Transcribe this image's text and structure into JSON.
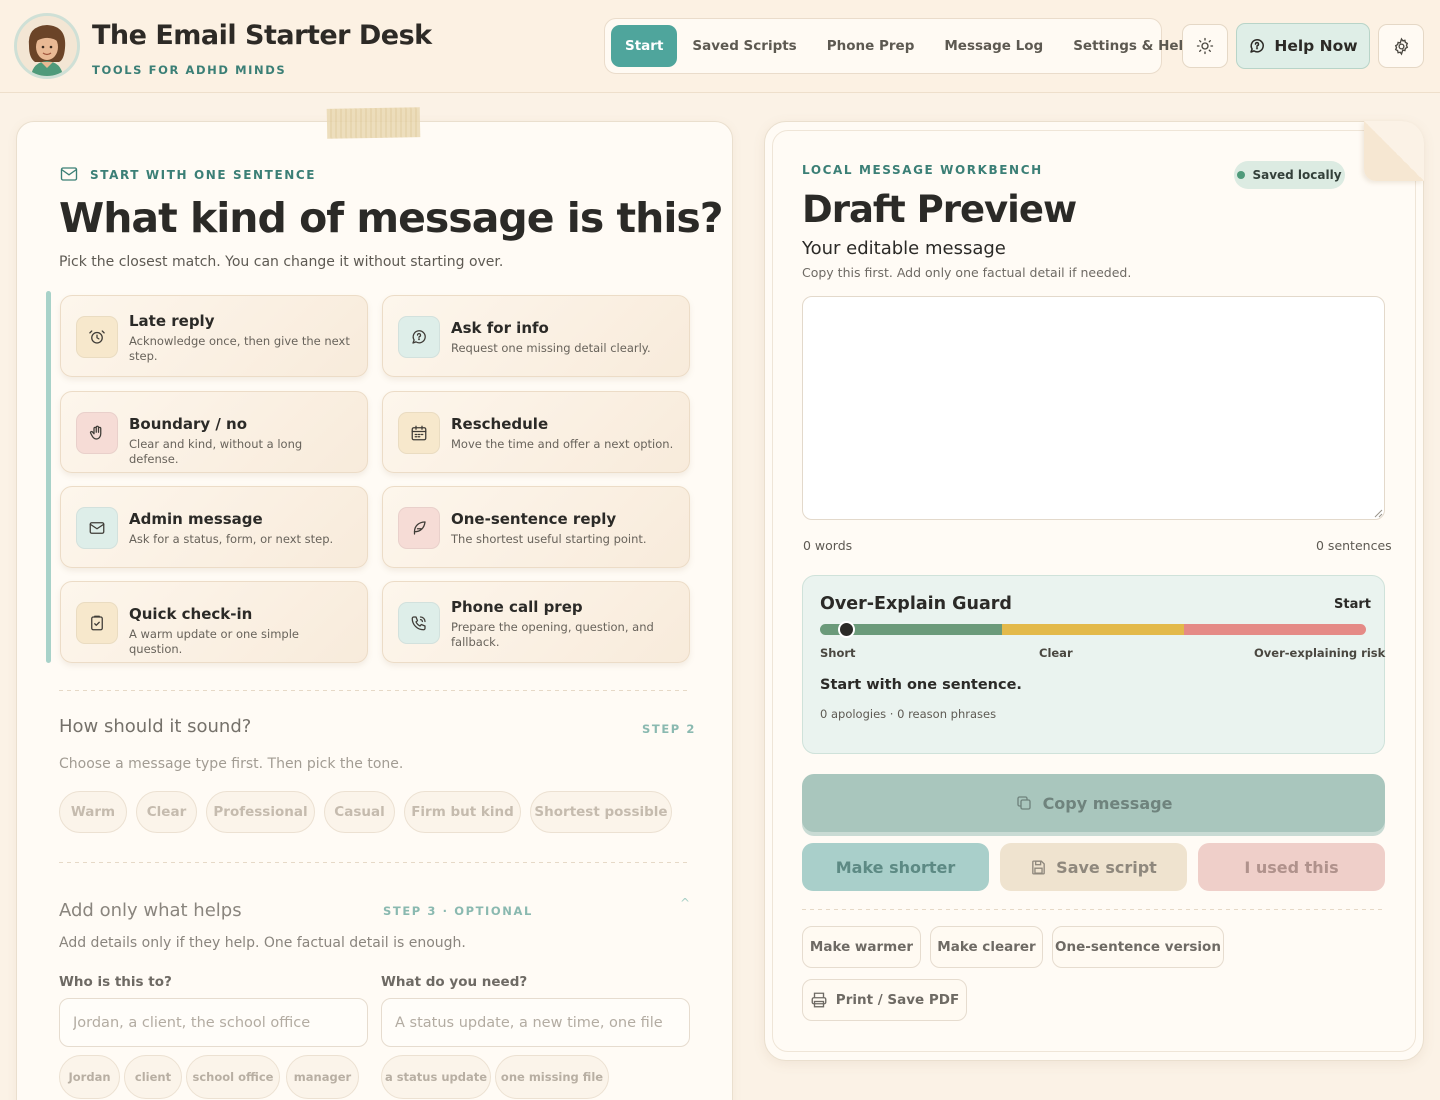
{
  "app": {
    "title": "The Email Starter Desk",
    "subtitle": "TOOLS FOR ADHD MINDS"
  },
  "nav": {
    "items": [
      "Start",
      "Saved Scripts",
      "Phone Prep",
      "Message Log",
      "Settings & Help"
    ],
    "active": "Start"
  },
  "header_actions": {
    "theme_icon": "sun-icon",
    "help_label": "Help Now",
    "settings_icon": "gear-icon"
  },
  "step1": {
    "eyebrow": "START WITH ONE SENTENCE",
    "title": "What kind of message is this?",
    "hint": "Pick the closest match. You can change it without starting over.",
    "types": [
      {
        "title": "Late reply",
        "desc": "Acknowledge once, then give the next step.",
        "icon": "clock-icon",
        "tint": "#f7e8cc"
      },
      {
        "title": "Ask for info",
        "desc": "Request one missing detail clearly.",
        "icon": "chat-question-icon",
        "tint": "#deeee9"
      },
      {
        "title": "Boundary / no",
        "desc": "Clear and kind, without a long defense.",
        "icon": "hand-icon",
        "tint": "#f6dcd6"
      },
      {
        "title": "Reschedule",
        "desc": "Move the time and offer a next option.",
        "icon": "calendar-icon",
        "tint": "#f7e8cc"
      },
      {
        "title": "Admin message",
        "desc": "Ask for a status, form, or next step.",
        "icon": "mail-icon",
        "tint": "#deeee9"
      },
      {
        "title": "One-sentence reply",
        "desc": "The shortest useful starting point.",
        "icon": "feather-icon",
        "tint": "#f6dcd6"
      },
      {
        "title": "Quick check-in",
        "desc": "A warm update or one simple question.",
        "icon": "clipboard-check-icon",
        "tint": "#f7e8cc"
      },
      {
        "title": "Phone call prep",
        "desc": "Prepare the opening, question, and fallback.",
        "icon": "phone-icon",
        "tint": "#deeee9"
      }
    ]
  },
  "step2": {
    "title": "How should it sound?",
    "tag": "STEP 2",
    "hint": "Choose a message type first. Then pick the tone.",
    "tones": [
      "Warm",
      "Clear",
      "Professional",
      "Casual",
      "Firm but kind",
      "Shortest possible"
    ]
  },
  "step3": {
    "title": "Add only what helps",
    "tag": "STEP 3 · OPTIONAL",
    "collapse_glyph": "^",
    "hint": "Add details only if they help. One factual detail is enough.",
    "who_label": "Who is this to?",
    "who_placeholder": "Jordan, a client, the school office",
    "who_suggestions": [
      "Jordan",
      "client",
      "school office",
      "manager"
    ],
    "need_label": "What do you need?",
    "need_placeholder": "A status update, a new time, one file",
    "need_suggestions": [
      "a status update",
      "one missing file"
    ]
  },
  "preview": {
    "eyebrow": "LOCAL MESSAGE WORKBENCH",
    "saved_badge": "Saved locally",
    "title": "Draft Preview",
    "subtitle": "Your editable message",
    "hint": "Copy this first. Add only one factual detail if needed.",
    "message": "",
    "words": "0 words",
    "sentences": "0 sentences"
  },
  "guard": {
    "title": "Over-Explain Guard",
    "status": "Start",
    "meter_position": 0.05,
    "meter_colors": [
      "#6b9a7a",
      "#e3b94a",
      "#e58a86"
    ],
    "labels": [
      "Short",
      "Clear",
      "Over-explaining risk"
    ],
    "advice": "Start with one sentence.",
    "stats": "0 apologies · 0 reason phrases"
  },
  "actions": {
    "copy": "Copy message",
    "shorter": "Make shorter",
    "save": "Save script",
    "used": "I used this",
    "warmer": "Make warmer",
    "clearer": "Make clearer",
    "one_sentence": "One-sentence version",
    "print": "Print / Save PDF"
  }
}
